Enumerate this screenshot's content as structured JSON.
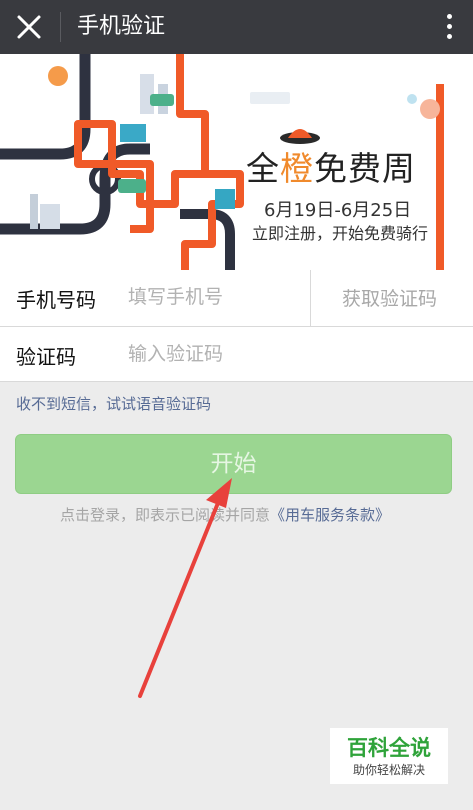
{
  "header": {
    "title": "手机验证",
    "close_icon": "close-icon",
    "more_icon": "more-vertical-icon",
    "bg_color": "#393a3f"
  },
  "banner": {
    "title_pre": "全",
    "title_highlight": "橙",
    "title_post": "免费周",
    "dates": "6月19日-6月25日",
    "subtitle": "立即注册，开始免费骑行",
    "accent_color": "#f05a28"
  },
  "form": {
    "phone_label": "手机号码",
    "phone_placeholder": "填写手机号",
    "phone_value": "",
    "get_code_label": "获取验证码",
    "code_label": "验证码",
    "code_placeholder": "输入验证码",
    "code_value": ""
  },
  "voice_link": "收不到短信，试试语音验证码",
  "start_button": "开始",
  "agreement": {
    "text": "点击登录，即表示已阅读并同意",
    "link": "《用车服务条款》"
  },
  "watermark": {
    "title": "百科全说",
    "subtitle": "助你轻松解决"
  },
  "colors": {
    "primary_green": "#9bd691",
    "link_blue": "#576b95",
    "annotation_red": "#e8413c"
  }
}
